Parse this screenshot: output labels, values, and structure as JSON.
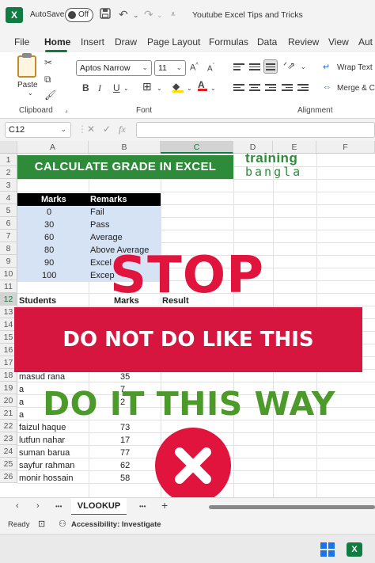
{
  "titlebar": {
    "app_icon": "X",
    "autosave_label": "AutoSave",
    "autosave_state": "Off",
    "doc_title": "Youtube Excel Tips and Tricks",
    "icons": [
      "save-icon",
      "undo-icon",
      "redo-icon",
      "customize-icon"
    ]
  },
  "menu_tabs": [
    "File",
    "Home",
    "Insert",
    "Draw",
    "Page Layout",
    "Formulas",
    "Data",
    "Review",
    "View",
    "Aut"
  ],
  "ribbon": {
    "clipboard": {
      "paste_label": "Paste",
      "group_label": "Clipboard"
    },
    "font": {
      "font_name": "Aptos Narrow",
      "font_size": "11",
      "group_label": "Font",
      "bold": "B",
      "italic": "I",
      "underline": "U"
    },
    "alignment": {
      "wrap_text": "Wrap Text",
      "merge_center": "Merge & C",
      "group_label": "Alignment"
    }
  },
  "formula_bar": {
    "name_box": "C12",
    "cancel": "✕",
    "enter": "✓",
    "fx": "fx",
    "formula": ""
  },
  "columns": [
    "A",
    "B",
    "C",
    "D",
    "E",
    "F"
  ],
  "rows": [
    "1",
    "2",
    "3",
    "4",
    "5",
    "6",
    "7",
    "8",
    "9",
    "10",
    "11",
    "12",
    "13",
    "14",
    "15",
    "16",
    "17",
    "18",
    "19",
    "20",
    "21",
    "22",
    "23",
    "24",
    "25",
    "26"
  ],
  "sheet": {
    "banner": "CALCULATE GRADE IN EXCEL",
    "logo_top": "training",
    "logo_bottom": "bangla",
    "grade_table": {
      "headers": [
        "Marks",
        "Remarks"
      ],
      "rows": [
        {
          "marks": "0",
          "remarks": "Fail"
        },
        {
          "marks": "30",
          "remarks": "Pass"
        },
        {
          "marks": "60",
          "remarks": "Average"
        },
        {
          "marks": "80",
          "remarks": "Above Average"
        },
        {
          "marks": "90",
          "remarks": "Excel"
        },
        {
          "marks": "100",
          "remarks": "Excep"
        }
      ]
    },
    "students_header": {
      "students": "Students",
      "marks": "Marks",
      "result": "Result"
    },
    "students": [
      {
        "name": "masud rana",
        "marks": "35"
      },
      {
        "name": "a",
        "marks": "7"
      },
      {
        "name": "a",
        "marks": "2"
      },
      {
        "name": "a",
        "marks": ""
      },
      {
        "name": "faizul haque",
        "marks": "73"
      },
      {
        "name": "lutfun nahar",
        "marks": "17"
      },
      {
        "name": "suman barua",
        "marks": "77"
      },
      {
        "name": "sayfur rahman",
        "marks": "62"
      },
      {
        "name": "monir hossain",
        "marks": "58"
      }
    ]
  },
  "overlay": {
    "stop": "STOP",
    "warning": "DO NOT DO LIKE THIS",
    "advice": "DO IT THIS WAY"
  },
  "sheet_tabs": {
    "prev": "‹",
    "next": "›",
    "more_left": "•••",
    "active": "VLOOKUP",
    "more_right": "•••",
    "add": "+"
  },
  "status": {
    "ready": "Ready",
    "accessibility": "Accessibility: Investigate"
  },
  "colors": {
    "excel_green": "#107c41",
    "banner_green": "#2e8b3a",
    "stop_red": "#e0143c",
    "warning_red": "#d6163f",
    "advice_green": "#4c9a2a"
  }
}
